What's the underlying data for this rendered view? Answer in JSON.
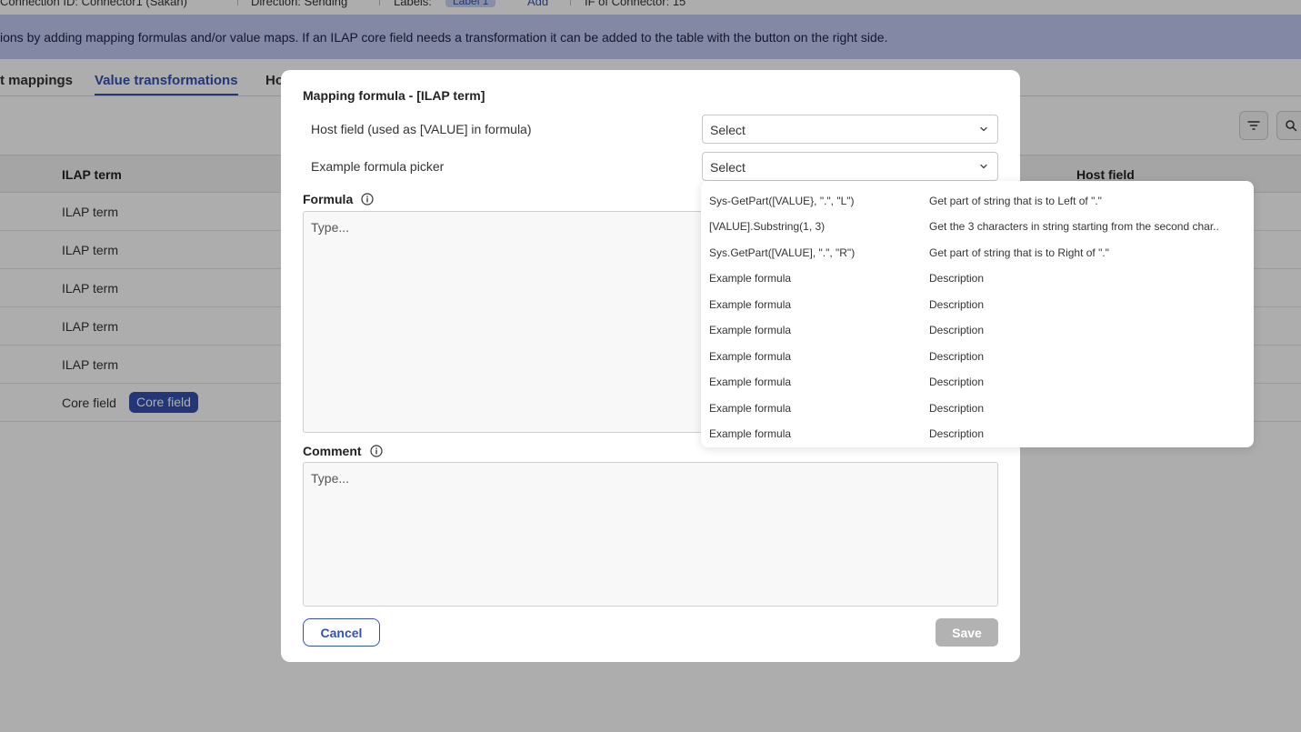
{
  "topbar": {
    "connection": "Connection ID: Connector1 (Sakan)",
    "direction": "Direction: Sending",
    "labels_label": "Labels:",
    "label_badge": "Label 1",
    "add_link": "Add",
    "connector": "IF of Connector: 15"
  },
  "banner": {
    "text": "ions by adding mapping formulas and/or value maps. If an ILAP core field needs a transformation it can be added to the table with the button on the right side."
  },
  "tabs": [
    {
      "label": "t mappings"
    },
    {
      "label": "Value transformations"
    },
    {
      "label": "Ho"
    }
  ],
  "grid": {
    "col_ilap": "ILAP term",
    "col_host": "Host field",
    "rows": [
      {
        "term": "ILAP term"
      },
      {
        "term": "ILAP term"
      },
      {
        "term": "ILAP term"
      },
      {
        "term": "ILAP term"
      },
      {
        "term": "ILAP term"
      },
      {
        "term": "Core field",
        "chip": "Core field"
      }
    ]
  },
  "modal": {
    "title": "Mapping formula - [ILAP term]",
    "host_field_label": "Host field (used as [VALUE] in formula)",
    "host_field_value": "Select",
    "picker_label": "Example formula picker",
    "picker_value": "Select",
    "formula_label": "Formula",
    "formula_placeholder": "Type...",
    "comment_label": "Comment",
    "comment_placeholder": "Type...",
    "cancel_label": "Cancel",
    "save_label": "Save"
  },
  "dropdown": {
    "options": [
      {
        "formula": "Sys-GetPart([VALUE}, \".\", \"L\")",
        "description": "Get part of string that is to Left of \".\""
      },
      {
        "formula": "[VALUE].Substring(1, 3)",
        "description": "Get the 3 characters in string starting from the second char.."
      },
      {
        "formula": "Sys.GetPart([VALUE], \".\", \"R\")",
        "description": "Get part of string that is to Right of \".\""
      },
      {
        "formula": "Example formula",
        "description": "Description"
      },
      {
        "formula": "Example formula",
        "description": "Description"
      },
      {
        "formula": "Example formula",
        "description": "Description"
      },
      {
        "formula": "Example formula",
        "description": "Description"
      },
      {
        "formula": "Example formula",
        "description": "Description"
      },
      {
        "formula": "Example formula",
        "description": "Description"
      },
      {
        "formula": "Example formula",
        "description": "Description"
      }
    ]
  },
  "colors": {
    "accent": "#3451b2",
    "banner": "#c1c9f2",
    "save_disabled": "#b2b2b2"
  }
}
